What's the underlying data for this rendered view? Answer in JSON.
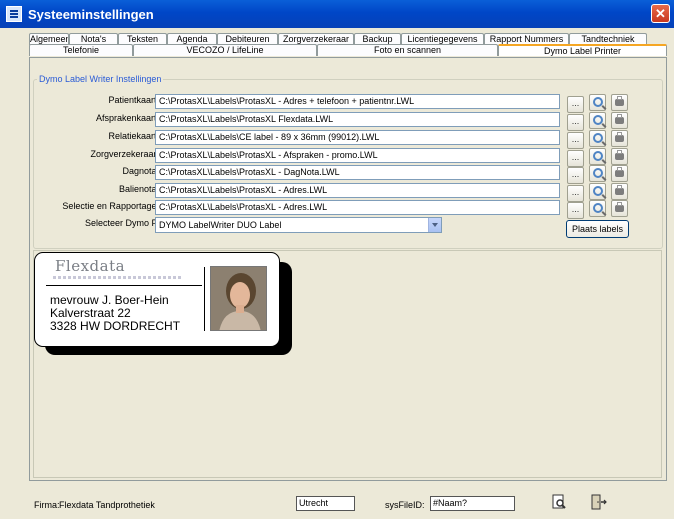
{
  "window": {
    "title": "Systeeminstellingen",
    "close_symbol": "✕",
    "icon": "window-app-icon"
  },
  "tabs_row1": [
    "Algemeen",
    "Nota's",
    "Teksten",
    "Agenda",
    "Debiteuren",
    "Zorgverzekeraar",
    "Backup",
    "Licentiegegevens",
    "Rapport Nummers",
    "Tandtechniek"
  ],
  "tabs_row2": [
    "Telefonie",
    "VECOZO / LifeLine",
    "Foto en scannen",
    "Dymo Label Printer"
  ],
  "active_tab": "Dymo Label Printer",
  "group": {
    "title": "Dymo Label Writer Instellingen",
    "rows": [
      {
        "label": "Patientkaart label",
        "path": "C:\\ProtasXL\\Labels\\ProtasXL - Adres + telefoon + patientnr.LWL"
      },
      {
        "label": "Afsprakenkaart label",
        "path": "C:\\ProtasXL\\Labels\\ProtasXL Flexdata.LWL"
      },
      {
        "label": "Relatiekaart label",
        "path": "C:\\ProtasXL\\Labels\\CE label - 89 x 36mm (99012).LWL"
      },
      {
        "label": "Zorgverzekeraar label",
        "path": "C:\\ProtasXL\\Labels\\ProtasXL - Afspraken - promo.LWL"
      },
      {
        "label": "Dagnota label",
        "path": "C:\\ProtasXL\\Labels\\ProtasXL - DagNota.LWL"
      },
      {
        "label": "Balienota label",
        "path": "C:\\ProtasXL\\Labels\\ProtasXL - Adres.LWL"
      },
      {
        "label": "Selectie en Rapportage label",
        "path": "C:\\ProtasXL\\Labels\\ProtasXL - Adres.LWL"
      }
    ],
    "browse_label": "...",
    "printer_label": "Selecteer Dymo Printer",
    "printer_value": "DYMO LabelWriter DUO Label",
    "plaats_button": "Plaats labels"
  },
  "preview": {
    "logo_text": "Flexdata",
    "name": "mevrouw J. Boer-Hein",
    "street": "Kalverstraat 22",
    "city": "3328 HW DORDRECHT"
  },
  "status": {
    "firma_label": "Firma:",
    "firma_value": "Flexdata Tandprothetiek",
    "city": "Utrecht",
    "sysfile_label": "sysFileID:",
    "sysfile_value": "#Naam?"
  },
  "icons": {
    "browse": "ellipsis-icon",
    "preview": "magnifier-icon",
    "print": "printer-icon",
    "footer_left": "print-preview-icon",
    "footer_right": "exit-door-icon"
  }
}
